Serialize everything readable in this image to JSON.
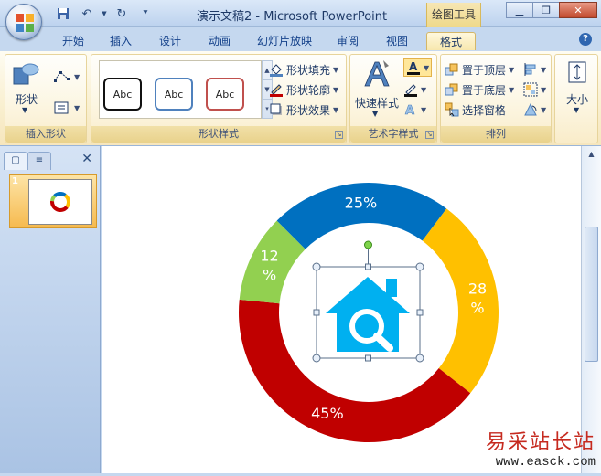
{
  "window": {
    "title": "演示文稿2 - Microsoft PowerPoint",
    "contextual_tab": "绘图工具"
  },
  "tabs": [
    {
      "label": "开始"
    },
    {
      "label": "插入"
    },
    {
      "label": "设计"
    },
    {
      "label": "动画"
    },
    {
      "label": "幻灯片放映"
    },
    {
      "label": "审阅"
    },
    {
      "label": "视图"
    },
    {
      "label": "格式",
      "active": true
    }
  ],
  "ribbon": {
    "insert_shapes": {
      "label": "插入形状",
      "shape_button": "形状"
    },
    "shape_styles": {
      "label": "形状样式",
      "samples": [
        "Abc",
        "Abc",
        "Abc"
      ],
      "sample_borders": [
        "#111111",
        "#4f81bd",
        "#c0504d"
      ],
      "fill": "形状填充",
      "outline": "形状轮廓",
      "effects": "形状效果"
    },
    "wordart": {
      "label": "艺术字样式",
      "quick_styles": "快速样式"
    },
    "arrange": {
      "label": "排列",
      "bring_front": "置于顶层",
      "send_back": "置于底层",
      "selection_pane": "选择窗格"
    },
    "size": {
      "label": "大小"
    }
  },
  "slides_panel": {
    "slide_number": "1"
  },
  "slide": {
    "donut_segments": [
      {
        "label": "25%",
        "value": 25,
        "color": "#0070c0"
      },
      {
        "label": "28\n%",
        "value": 28,
        "color": "#ffc000"
      },
      {
        "label": "45%",
        "value": 45,
        "color": "#c00000"
      },
      {
        "label": "12\n%",
        "value": 12,
        "color": "#92d050"
      }
    ],
    "icon": "house-search-icon",
    "icon_color": "#00b0f0"
  },
  "watermark": {
    "title": "易采站长站",
    "url": "www.easck.com"
  }
}
